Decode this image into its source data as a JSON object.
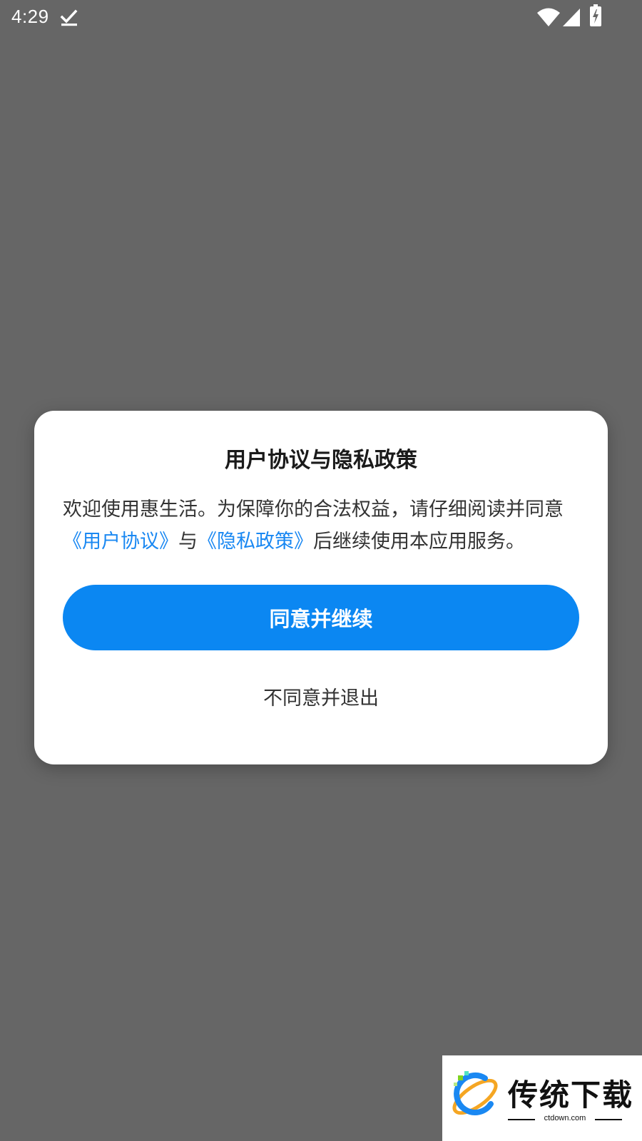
{
  "status_bar": {
    "time": "4:29",
    "icons": [
      "download-done-icon",
      "wifi-icon",
      "cell-signal-icon",
      "battery-charging-icon"
    ]
  },
  "dialog": {
    "title": "用户协议与隐私政策",
    "body": {
      "part1": "欢迎使用惠生活。为保障你的合法权益，请仔细阅读并同意",
      "link1": "《用户协议》",
      "part2": "与",
      "link2": "《隐私政策》",
      "part3": "后继续使用本应用服务。"
    },
    "agree_label": "同意并继续",
    "decline_label": "不同意并退出"
  },
  "watermark": {
    "text": "传统下载",
    "domain": "ctdown.com"
  },
  "colors": {
    "accent": "#0b87f2",
    "link": "#1a88f2",
    "overlay": "#666666"
  }
}
